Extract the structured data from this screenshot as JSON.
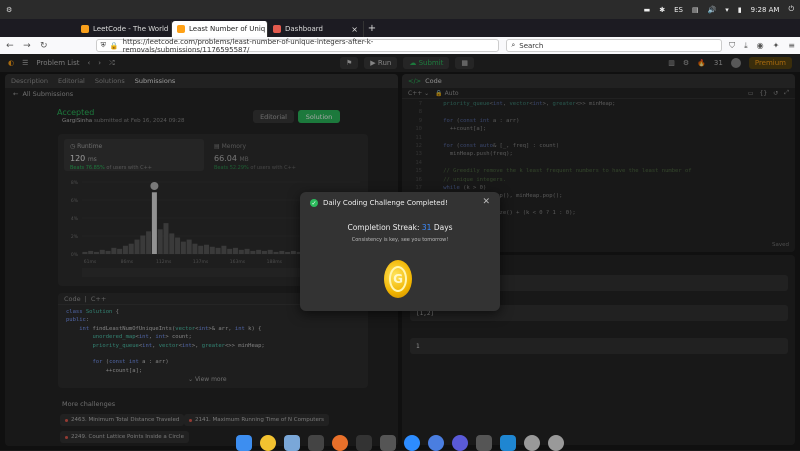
{
  "system": {
    "time": "9:28 AM",
    "lang": "ES"
  },
  "browser": {
    "tabs": [
      {
        "label": "LeetCode - The World"
      },
      {
        "label": "Least Number of Uniq"
      },
      {
        "label": "Dashboard"
      }
    ],
    "url": "https://leetcode.com/problems/least-number-of-unique-integers-after-k-removals/submissions/1176595587/",
    "search_placeholder": "Search"
  },
  "leetcode": {
    "problem_list": "Problem List",
    "run": "Run",
    "submit": "Submit",
    "streak_badge": "31",
    "premium": "Premium",
    "left_tabs": [
      "Description",
      "Editorial",
      "Solutions",
      "Submissions"
    ],
    "all_submissions": "All Submissions",
    "status": "Accepted",
    "author": "GargiSinha",
    "submitted": "submitted at Feb 16, 2024 09:28",
    "editorial_btn": "Editorial",
    "solution_btn": "Solution",
    "runtime": {
      "label": "Runtime",
      "value": "120",
      "unit": "ms",
      "beats": "Beats",
      "beats_pct": "76.85%",
      "beats_suffix": "of users with C++"
    },
    "memory": {
      "label": "Memory",
      "value": "66.04",
      "unit": "MB",
      "beats": "Beats",
      "beats_pct": "52.29%",
      "beats_suffix": "of users with C++"
    },
    "x_ticks": [
      "61ms",
      "86ms",
      "112ms",
      "137ms",
      "163ms",
      "188ms",
      "214ms",
      "240ms"
    ],
    "y_ticks": [
      "8%",
      "6%",
      "4%",
      "2%",
      "0%"
    ],
    "code_label": "Code",
    "code_lang": "C++",
    "view_more": "View more",
    "more_challenges": "More challenges",
    "challenges": [
      "2463. Minimum Total Distance Traveled",
      "2141. Maximum Running Time of N Computers",
      "2249. Count Lattice Points Inside a Circle"
    ],
    "right_code_title": "Code",
    "right_code_lang": "C++",
    "right_code_auto": "Auto",
    "saved": "Saved",
    "console_values": [
      "[]",
      "[1,2]",
      "1"
    ]
  },
  "modal": {
    "title": "Daily Coding Challenge Completed!",
    "streak_label": "Completion Streak:",
    "streak_num": "31",
    "streak_unit": "Days",
    "subtitle": "Consistency is key, see you tomorrow!"
  }
}
